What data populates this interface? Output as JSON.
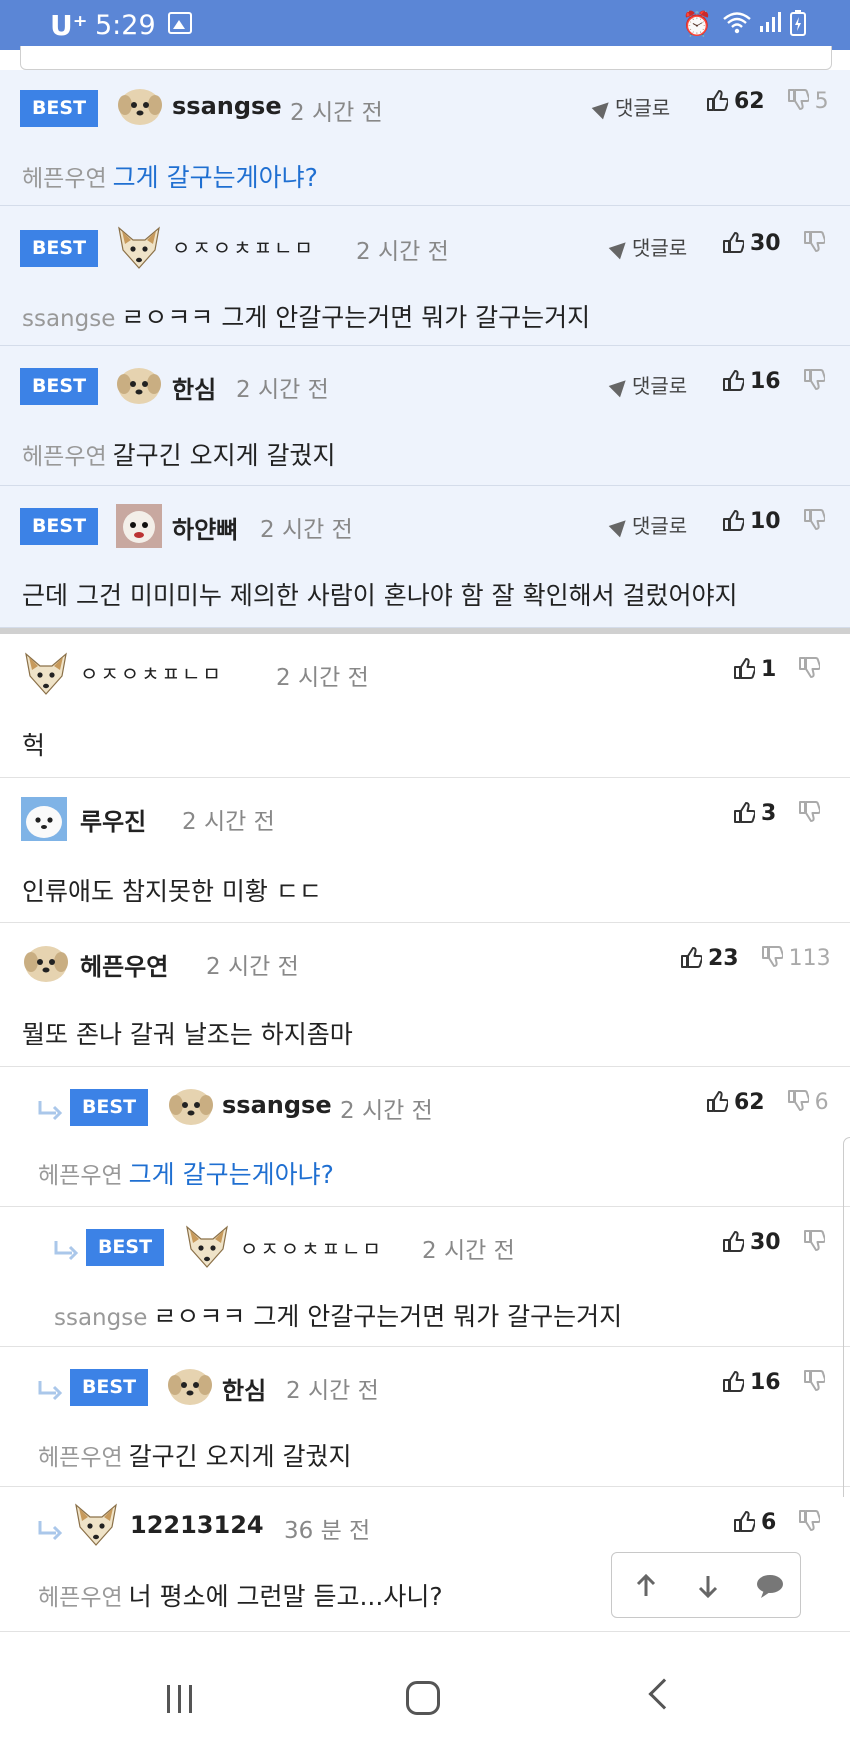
{
  "status_bar": {
    "carrier": "U⁺",
    "time": "5:29"
  },
  "colors": {
    "status_bar": "#5b86d6",
    "best_badge": "#3c82e6",
    "best_bg": "#eef3fc",
    "link": "#1f6fd1"
  },
  "labels": {
    "best": "BEST",
    "reply": "댓글로"
  },
  "comments": [
    {
      "nick": "ssangse",
      "time": "2 시간 전",
      "up": "62",
      "down": "5",
      "target": "헤픈우연",
      "text": "그게 갈구는게아냐?"
    },
    {
      "nick": "ㅇㅈㅇㅊㅍㄴㅁ",
      "time": "2 시간 전",
      "up": "30",
      "down": "",
      "target": "ssangse",
      "text": "ㄹㅇㅋㅋ 그게 안갈구는거면 뭐가 갈구는거지"
    },
    {
      "nick": "한심",
      "time": "2 시간 전",
      "up": "16",
      "down": "",
      "target": "헤픈우연",
      "text": "갈구긴 오지게 갈궜지"
    },
    {
      "nick": "하얀뼈",
      "time": "2 시간 전",
      "up": "10",
      "down": "",
      "target": "",
      "text": "근데 그건 미미미누 제의한 사람이 혼나야 함 잘 확인해서 걸렀어야지"
    },
    {
      "nick": "ㅇㅈㅇㅊㅍㄴㅁ",
      "time": "2 시간 전",
      "up": "1",
      "down": "",
      "target": "",
      "text": "헉"
    },
    {
      "nick": "루우진",
      "time": "2 시간 전",
      "up": "3",
      "down": "",
      "target": "",
      "text": "인류애도 참지못한 미황 ㄷㄷ"
    },
    {
      "nick": "헤픈우연",
      "time": "2 시간 전",
      "up": "23",
      "down": "113",
      "target": "",
      "text": "뭘또 존나 갈궈 날조는 하지좀마"
    },
    {
      "nick": "ssangse",
      "time": "2 시간 전",
      "up": "62",
      "down": "6",
      "target": "헤픈우연",
      "text": "그게 갈구는게아냐?"
    },
    {
      "nick": "ㅇㅈㅇㅊㅍㄴㅁ",
      "time": "2 시간 전",
      "up": "30",
      "down": "",
      "target": "ssangse",
      "text": "ㄹㅇㅋㅋ 그게 안갈구는거면 뭐가 갈구는거지"
    },
    {
      "nick": "한심",
      "time": "2 시간 전",
      "up": "16",
      "down": "",
      "target": "헤픈우연",
      "text": "갈구긴 오지게 갈궜지"
    },
    {
      "nick": "12213124",
      "time": "36 분 전",
      "up": "6",
      "down": "",
      "target": "헤픈우연",
      "text": "너 평소에 그런말 듣고...사니?"
    }
  ]
}
